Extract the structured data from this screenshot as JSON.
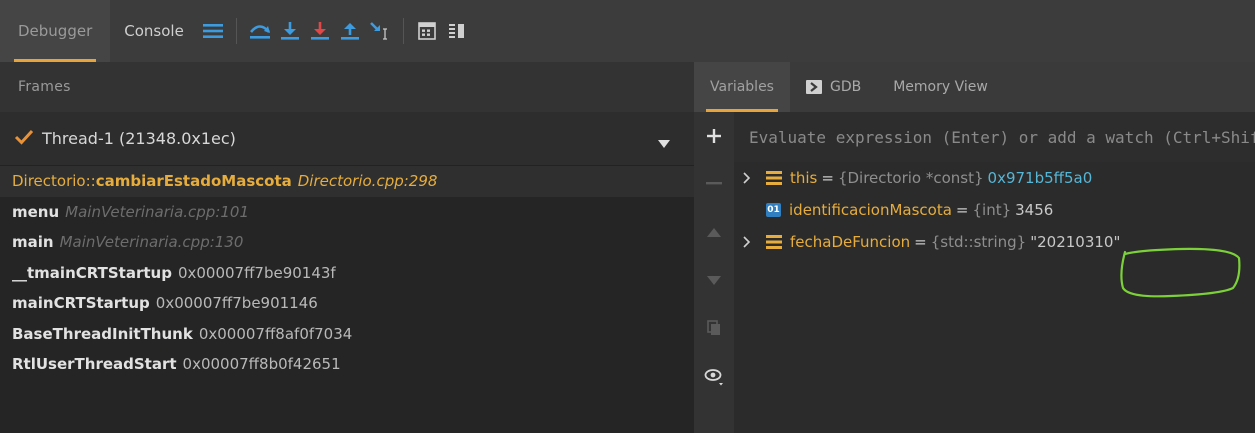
{
  "toolbar": {
    "debugger_tab": "Debugger",
    "console_tab": "Console",
    "icons": [
      "menu-icon",
      "step-over-icon",
      "step-into-icon",
      "step-into-force-icon",
      "step-out-icon",
      "run-to-cursor-icon",
      "evaluate-icon",
      "columns-icon"
    ],
    "accent_color": "#e8a33a"
  },
  "frames": {
    "header": "Frames",
    "thread": "Thread-1 (21348.0x1ec)",
    "items": [
      {
        "ns": "Directorio::",
        "fn": "cambiarEstadoMascota",
        "loc": "Directorio.cpp:298",
        "addr": ""
      },
      {
        "ns": "",
        "fn": "menu",
        "loc": "MainVeterinaria.cpp:101",
        "addr": ""
      },
      {
        "ns": "",
        "fn": "main",
        "loc": "MainVeterinaria.cpp:130",
        "addr": ""
      },
      {
        "ns": "",
        "fn": "__tmainCRTStartup",
        "loc": "",
        "addr": "0x00007ff7be90143f"
      },
      {
        "ns": "",
        "fn": "mainCRTStartup",
        "loc": "",
        "addr": "0x00007ff7be901146"
      },
      {
        "ns": "",
        "fn": "BaseThreadInitThunk",
        "loc": "",
        "addr": "0x00007ff8af0f7034"
      },
      {
        "ns": "",
        "fn": "RtlUserThreadStart",
        "loc": "",
        "addr": "0x00007ff8b0f42651"
      }
    ]
  },
  "right": {
    "tabs": {
      "variables": "Variables",
      "gdb": "GDB",
      "memory": "Memory View"
    },
    "eval_placeholder": "Evaluate expression (Enter) or add a watch (Ctrl+Shift+Enter)",
    "variables": [
      {
        "name": "this",
        "eq": " = ",
        "type": "{Directorio *const}",
        "value": "0x971b5ff5a0",
        "expandable": true,
        "kind": "struct"
      },
      {
        "name": "identificacionMascota",
        "eq": " = ",
        "type": "{int}",
        "value": "3456",
        "expandable": false,
        "kind": "int"
      },
      {
        "name": "fechaDeFuncion",
        "eq": " = ",
        "type": "{std::string}",
        "value": "\"20210310\"",
        "expandable": true,
        "kind": "struct"
      }
    ],
    "int_badge": "01"
  }
}
